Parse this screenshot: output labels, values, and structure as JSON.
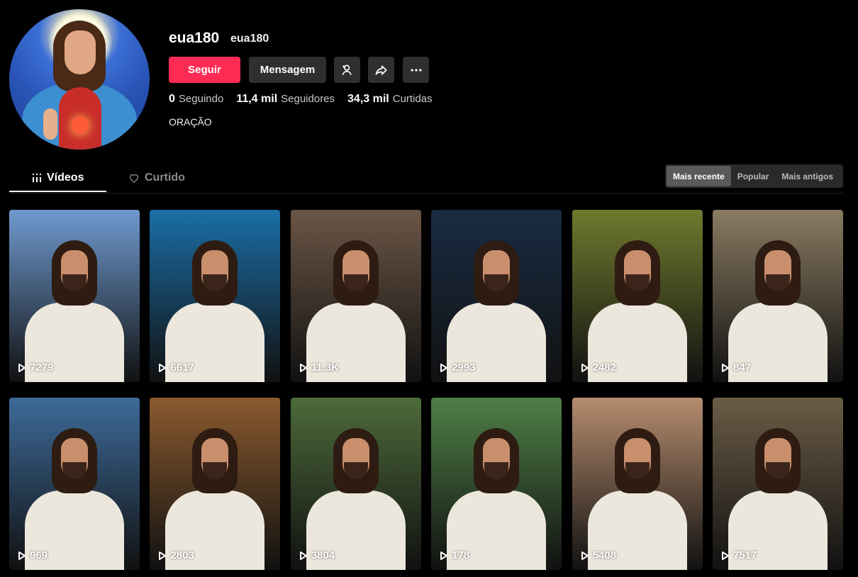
{
  "profile": {
    "username": "eua180",
    "nickname": "eua180",
    "bio": "ORAÇÃO"
  },
  "actions": {
    "follow_label": "Seguir",
    "message_label": "Mensagem",
    "add_friend_icon": "add-user-icon",
    "share_icon": "share-icon",
    "more_icon": "more-icon"
  },
  "stats": [
    {
      "value": "0",
      "label": "Seguindo"
    },
    {
      "value": "11,4 mil",
      "label": "Seguidores"
    },
    {
      "value": "34,3 mil",
      "label": "Curtidas"
    }
  ],
  "tabs": [
    {
      "label": "Vídeos",
      "icon": "grid-icon",
      "active": true
    },
    {
      "label": "Curtido",
      "icon": "heart-icon",
      "active": false
    }
  ],
  "sort": [
    {
      "label": "Mais recente",
      "active": true
    },
    {
      "label": "Popular",
      "active": false
    },
    {
      "label": "Mais antigos",
      "active": false
    }
  ],
  "videos": [
    {
      "views": "7279",
      "bg": "#6f9ad0"
    },
    {
      "views": "6617",
      "bg": "#1b6ea6"
    },
    {
      "views": "11.3K",
      "bg": "#6b5646"
    },
    {
      "views": "2993",
      "bg": "#1a2c44"
    },
    {
      "views": "2482",
      "bg": "#6f7a2e"
    },
    {
      "views": "847",
      "bg": "#8a7b62"
    },
    {
      "views": "969",
      "bg": "#3e6b9a"
    },
    {
      "views": "2803",
      "bg": "#8a5a2e"
    },
    {
      "views": "3804",
      "bg": "#4d6b3a"
    },
    {
      "views": "178",
      "bg": "#4e7f46"
    },
    {
      "views": "5408",
      "bg": "#b58c6e"
    },
    {
      "views": "7517",
      "bg": "#6b5c46"
    }
  ]
}
